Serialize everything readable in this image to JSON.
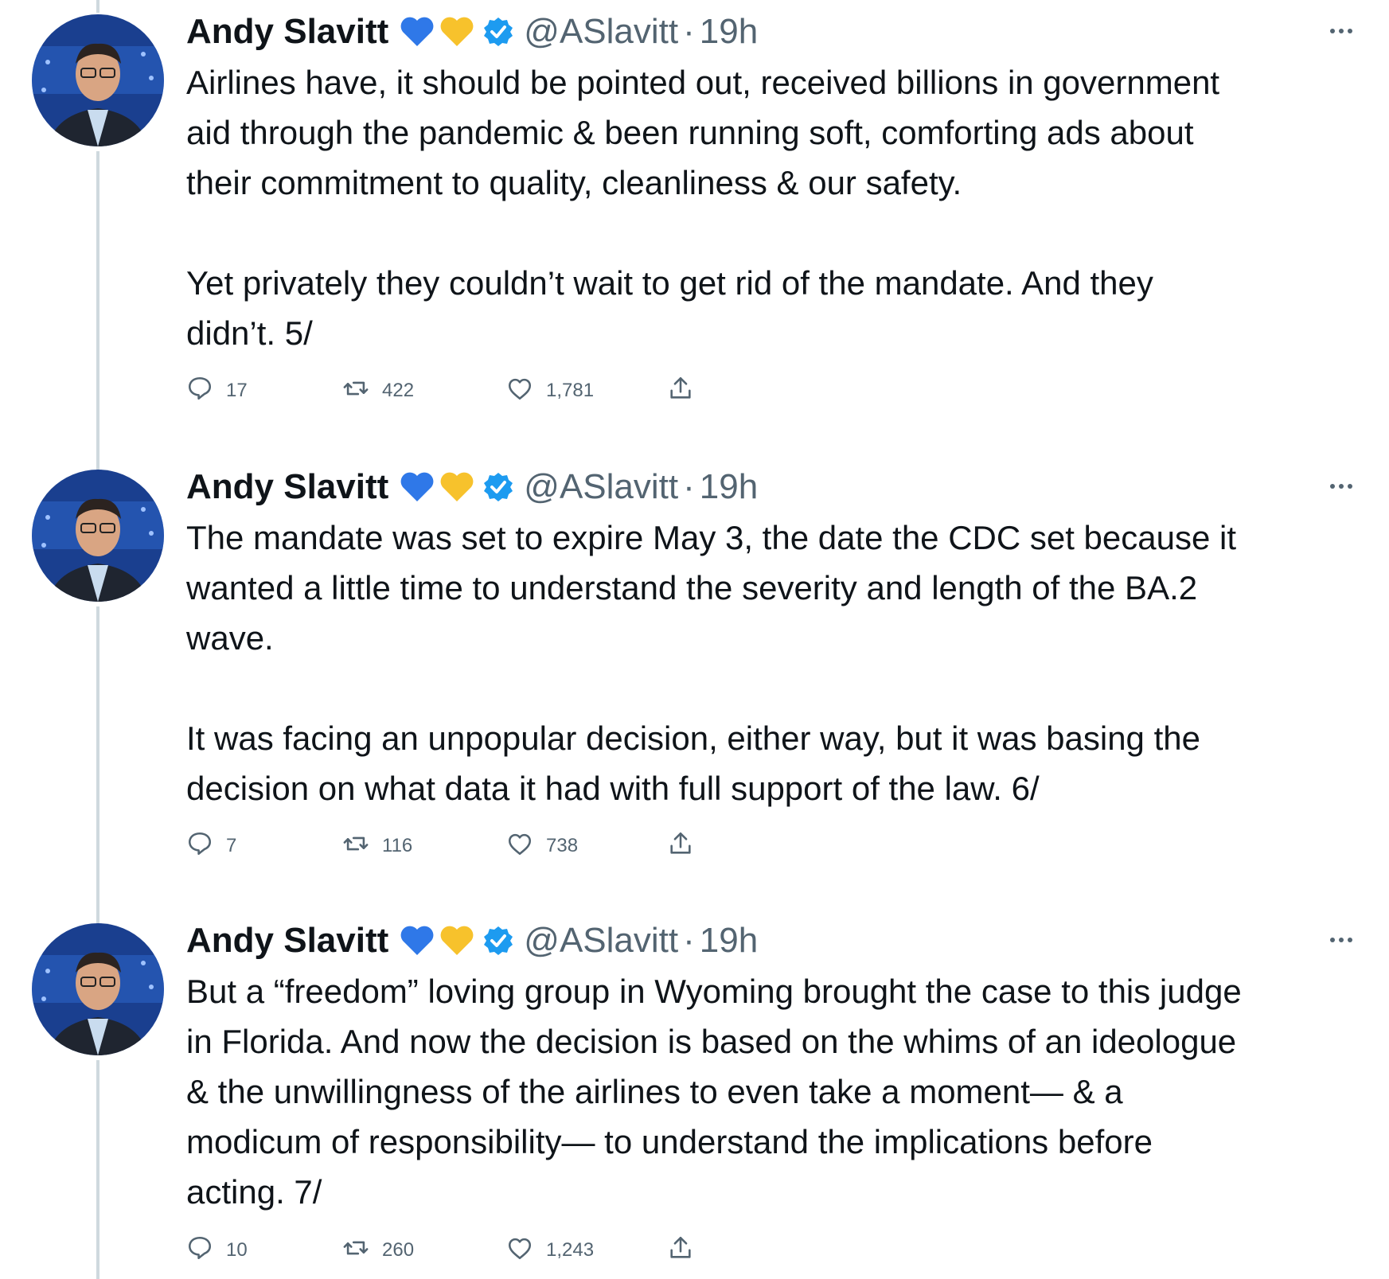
{
  "tweets": [
    {
      "author": "Andy Slavitt",
      "emojis": [
        "blue-heart",
        "yellow-heart"
      ],
      "verified": true,
      "handle": "@ASlavitt",
      "separator": "·",
      "time": "19h",
      "text": "Airlines have, it should be pointed out, received billions in government\naid through the pandemic & been running soft, comforting ads about\ntheir commitment to quality, cleanliness & our safety.\n\nYet privately they couldn’t wait to get rid of the mandate. And they\ndidn’t. 5/",
      "replies": "17",
      "retweets": "422",
      "likes": "1,781"
    },
    {
      "author": "Andy Slavitt",
      "emojis": [
        "blue-heart",
        "yellow-heart"
      ],
      "verified": true,
      "handle": "@ASlavitt",
      "separator": "·",
      "time": "19h",
      "text": "The mandate was set to expire May 3, the date the CDC set because it\nwanted a little time to understand the severity and length of the BA.2\nwave.\n\nIt was facing an unpopular decision, either way, but it was basing the\ndecision on what data it had with full support of the law. 6/",
      "replies": "7",
      "retweets": "116",
      "likes": "738"
    },
    {
      "author": "Andy Slavitt",
      "emojis": [
        "blue-heart",
        "yellow-heart"
      ],
      "verified": true,
      "handle": "@ASlavitt",
      "separator": "·",
      "time": "19h",
      "text": "But a “freedom” loving group in Wyoming brought the case to this judge\nin Florida. And now the decision is based on the whims of an ideologue\n& the unwillingness of the airlines to even take a moment— & a\nmodicum of responsibility— to understand the implications before\nacting. 7/",
      "replies": "10",
      "retweets": "260",
      "likes": "1,243"
    }
  ],
  "colors": {
    "text": "#0f1419",
    "secondary": "#536471",
    "verified": "#1d9bf0",
    "thread_line": "#cfd9de"
  },
  "icons": {
    "reply": "reply-icon",
    "retweet": "retweet-icon",
    "like": "like-icon",
    "share": "share-icon",
    "more": "more-icon",
    "verified": "verified-badge-icon"
  }
}
